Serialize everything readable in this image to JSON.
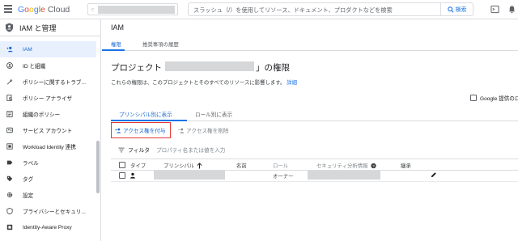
{
  "topbar": {
    "logo_google": "Google",
    "logo_cloud": "Cloud",
    "search_placeholder": "スラッシュ（/）を使用してリソース、ドキュメント、プロダクトなどを検索",
    "search_button": "検索"
  },
  "sidebar": {
    "title": "IAM と管理",
    "items": [
      {
        "label": "IAM",
        "icon": "person-add-icon",
        "active": true
      },
      {
        "label": "ID と組織",
        "icon": "account-circle-icon"
      },
      {
        "label": "ポリシーに関するトラブ...",
        "icon": "wrench-icon"
      },
      {
        "label": "ポリシー アナライザ",
        "icon": "document-search-icon"
      },
      {
        "label": "組織のポリシー",
        "icon": "list-document-icon"
      },
      {
        "label": "サービス アカウント",
        "icon": "service-account-icon"
      },
      {
        "label": "Workload Identity 連携",
        "icon": "workload-identity-icon"
      },
      {
        "label": "ラベル",
        "icon": "label-icon"
      },
      {
        "label": "タグ",
        "icon": "tag-icon"
      },
      {
        "label": "設定",
        "icon": "gear-icon"
      },
      {
        "label": "プライバシーとセキュリ...",
        "icon": "shield-icon"
      },
      {
        "label": "Identity-Aware Proxy",
        "icon": "iap-icon"
      }
    ]
  },
  "main": {
    "title": "IAM",
    "tabs": [
      {
        "label": "権限",
        "active": true
      },
      {
        "label": "推奨事項の履歴",
        "active": false
      }
    ],
    "permissions": {
      "title_prefix": "プロジェクト「",
      "title_suffix": "」の権限",
      "description": "これらの権限は、このプロジェクトとそのすべてのリソースに影響します。",
      "details_link": "詳細"
    },
    "google_checkbox_label": "Google 提供のロ",
    "subtabs": [
      {
        "label": "プリンシパル別に表示",
        "active": true
      },
      {
        "label": "ロール別に表示",
        "active": false
      }
    ],
    "grant_button": "アクセス権を付与",
    "remove_button": "アクセス権を削除",
    "filter_label": "フィルタ",
    "filter_placeholder": "プロパティ名または値を入力",
    "table": {
      "columns": [
        "タイプ",
        "プリンシパル",
        "名前",
        "ロール",
        "セキュリティ分析情報",
        "継承"
      ],
      "rows": [
        {
          "role": "オーナー"
        }
      ]
    }
  }
}
